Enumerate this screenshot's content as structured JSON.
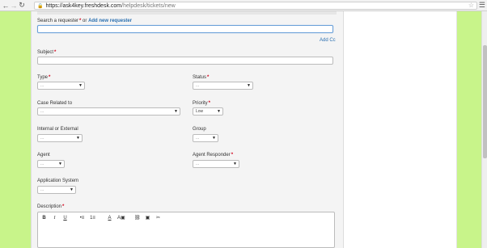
{
  "browser": {
    "url_host": "https://ask4key.freshdesk.com",
    "url_path": "/helpdesk/tickets/new"
  },
  "form": {
    "requester": {
      "label": "Search a requester",
      "or_text": "or",
      "add_link": "Add new requester",
      "value": ""
    },
    "add_cc": "Add Cc",
    "subject": {
      "label": "Subject",
      "value": ""
    },
    "type": {
      "label": "Type",
      "value": "..."
    },
    "status": {
      "label": "Status",
      "value": "..."
    },
    "case_related_to": {
      "label": "Case Related to",
      "value": "..."
    },
    "priority": {
      "label": "Priority",
      "value": "Low"
    },
    "internal_external": {
      "label": "Internal or External",
      "value": "..."
    },
    "group": {
      "label": "Group",
      "value": "..."
    },
    "agent": {
      "label": "Agent",
      "value": "..."
    },
    "agent_responder": {
      "label": "Agent Responder",
      "value": "..."
    },
    "application_system": {
      "label": "Application System",
      "value": "..."
    },
    "description": {
      "label": "Description",
      "toolbar": [
        "B",
        "I",
        "U",
        "•≡",
        "1≡",
        "A",
        "A▣",
        "⛓",
        "▣",
        "✂"
      ]
    }
  },
  "colors": {
    "background_green": "#c8f48a",
    "link_blue": "#2a6fb0",
    "required_red": "#d0021b"
  }
}
